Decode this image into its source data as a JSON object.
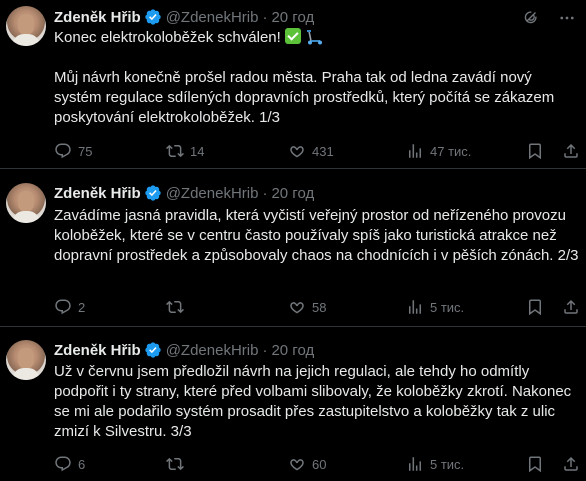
{
  "colors": {
    "background": "#000000",
    "text": "#e7e9ea",
    "muted": "#71767b",
    "verified": "#1d9bf0",
    "divider": "#2f3336"
  },
  "tweets": [
    {
      "author_name": "Zdeněk Hřib",
      "handle": "@ZdenekHrib",
      "separator": "·",
      "time": "20 год",
      "text_line1": "Konec elektrokoloběžek schválen! ",
      "text_body": "Můj návrh konečně prošel radou města. Praha tak od ledna zavádí nový systém regulace sdílených dopravních prostředků, který počítá se zákazem poskytování elektrokoloběžek. 1/3",
      "emojis": [
        "white-check-mark-emoji",
        "kick-scooter-emoji"
      ],
      "replies": "75",
      "retweets": "14",
      "likes": "431",
      "views": "47 тис."
    },
    {
      "author_name": "Zdeněk Hřib",
      "handle": "@ZdenekHrib",
      "separator": "·",
      "time": "20 год",
      "text_body": "Zavádíme jasná pravidla, která vyčistí veřejný prostor od neřízeného provozu koloběžek, které se v centru často používaly spíš jako turistická atrakce než dopravní prostředek a způsobovaly chaos na chodnících i v pěších zónách. 2/3",
      "replies": "2",
      "retweets": "",
      "likes": "58",
      "views": "5 тис."
    },
    {
      "author_name": "Zdeněk Hřib",
      "handle": "@ZdenekHrib",
      "separator": "·",
      "time": "20 год",
      "text_body": "Už v červnu jsem předložil návrh na jejich regulaci, ale tehdy ho odmítly podpořit i ty strany, které před volbami slibovaly, že koloběžky zkrotí. Nakonec se mi ale podařilo systém prosadit přes zastupitelstvo a koloběžky tak z ulic zmizí k Silvestru. 3/3",
      "replies": "6",
      "retweets": "",
      "likes": "60",
      "views": "5 тис."
    }
  ],
  "icons": [
    "verified-badge-icon",
    "grok-icon",
    "more-icon",
    "reply-icon",
    "retweet-icon",
    "like-icon",
    "views-icon",
    "bookmark-icon",
    "share-icon"
  ]
}
